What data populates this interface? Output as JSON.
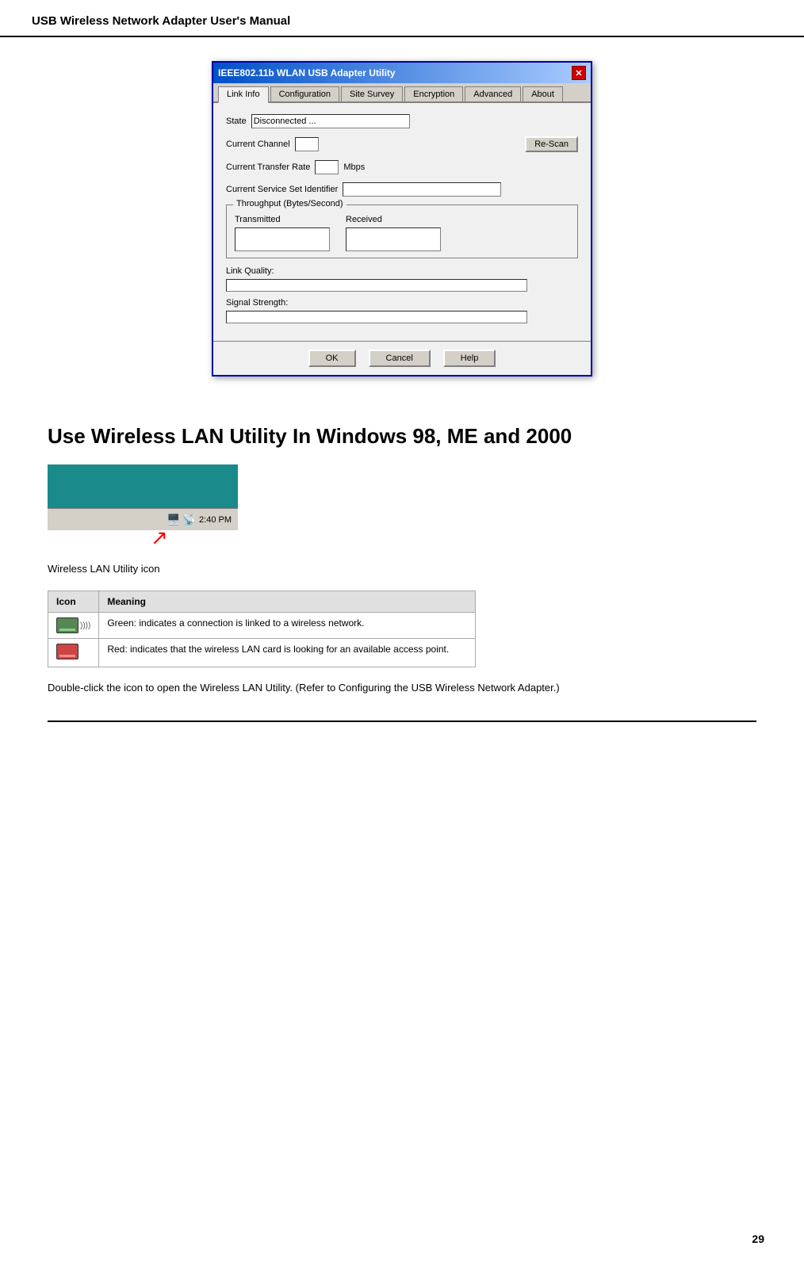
{
  "header": {
    "title": "USB Wireless Network Adapter User's Manual"
  },
  "dialog": {
    "title": "IEEE802.11b WLAN USB Adapter Utility",
    "tabs": [
      {
        "label": "Link Info",
        "active": true
      },
      {
        "label": "Configuration"
      },
      {
        "label": "Site Survey"
      },
      {
        "label": "Encryption"
      },
      {
        "label": "Advanced"
      },
      {
        "label": "About"
      }
    ],
    "state_label": "State",
    "state_value": "Disconnected ...",
    "channel_label": "Current Channel",
    "rescan_label": "Re-Scan",
    "transfer_rate_label": "Current Transfer Rate",
    "transfer_rate_unit": "Mbps",
    "ssid_label": "Current Service Set Identifier",
    "throughput_legend": "Throughput (Bytes/Second)",
    "transmitted_label": "Transmitted",
    "received_label": "Received",
    "link_quality_label": "Link Quality:",
    "signal_strength_label": "Signal Strength:",
    "ok_label": "OK",
    "cancel_label": "Cancel",
    "help_label": "Help"
  },
  "section": {
    "heading": "Use Wireless LAN Utility In Windows 98, ME and 2000"
  },
  "taskbar": {
    "time": "2:40 PM",
    "caption": "Wireless LAN Utility icon"
  },
  "icon_table": {
    "col_icon": "Icon",
    "col_meaning": "Meaning",
    "rows": [
      {
        "icon_color": "green",
        "meaning": "Green: indicates a connection is linked to a wireless network."
      },
      {
        "icon_color": "red",
        "meaning": "Red: indicates that the wireless LAN card is looking for an available access point."
      }
    ]
  },
  "description": "Double-click the icon to open the Wireless LAN Utility. (Refer to Configuring the USB Wireless Network Adapter.)",
  "page_number": "29"
}
